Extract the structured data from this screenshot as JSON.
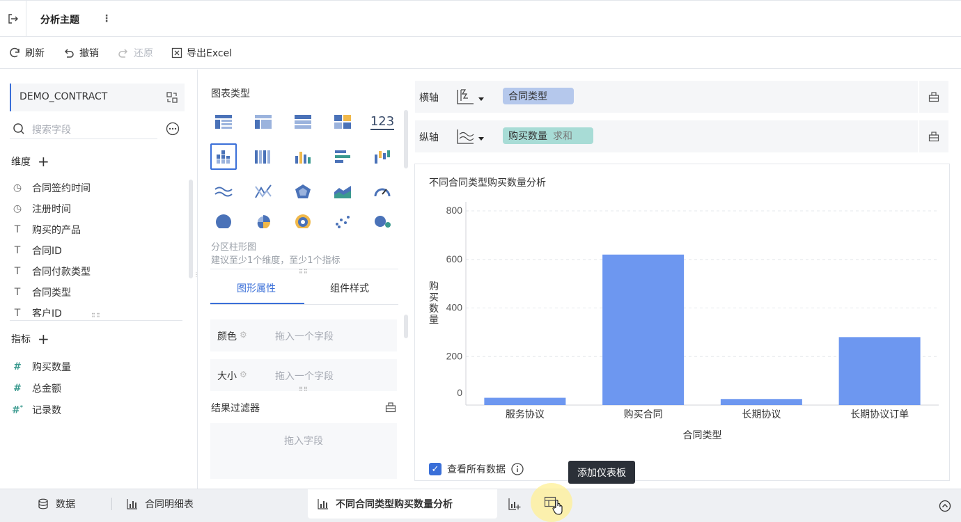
{
  "topbar": {
    "title": "分析主题"
  },
  "toolbar": {
    "refresh": "刷新",
    "undo": "撤销",
    "redo": "还原",
    "export": "导出Excel"
  },
  "left": {
    "table_name": "DEMO_CONTRACT",
    "search_placeholder": "搜索字段",
    "dimensions_title": "维度",
    "dimensions": [
      {
        "label": "合同签约时间",
        "icon": "clock-icon"
      },
      {
        "label": "注册时间",
        "icon": "clock-icon"
      },
      {
        "label": "购买的产品",
        "icon": "text-icon"
      },
      {
        "label": "合同ID",
        "icon": "text-icon"
      },
      {
        "label": "合同付款类型",
        "icon": "text-icon"
      },
      {
        "label": "合同类型",
        "icon": "text-icon"
      },
      {
        "label": "客户ID",
        "icon": "text-icon"
      }
    ],
    "measures_title": "指标",
    "measures": [
      {
        "label": "购买数量",
        "icon": "hash-icon"
      },
      {
        "label": "总金额",
        "icon": "hash-icon"
      },
      {
        "label": "记录数",
        "icon": "hash-star-icon"
      }
    ]
  },
  "middle": {
    "chart_type_title": "图表类型",
    "chart_type_name": "分区柱形图",
    "chart_type_hint": "建议至少1个维度，至少1个指标",
    "tabs": {
      "graph": "图形属性",
      "style": "组件样式"
    },
    "color_label": "颜色",
    "size_label": "大小",
    "drop_placeholder": "拖入一个字段",
    "filter_title": "结果过滤器",
    "filter_placeholder": "拖入字段",
    "number_icon_text": "123"
  },
  "axes": {
    "x_label": "横轴",
    "y_label": "纵轴",
    "x_field": "合同类型",
    "y_field": "购买数量",
    "y_agg": "求和"
  },
  "chart_data": {
    "type": "bar",
    "title": "不同合同类型购买数量分析",
    "categories": [
      "服务协议",
      "购买合同",
      "长期协议",
      "长期协议订单"
    ],
    "values": [
      30,
      620,
      25,
      280
    ],
    "xlabel": "合同类型",
    "ylabel": "购买数量",
    "ylim": [
      0,
      800
    ],
    "yticks": [
      "0",
      "200",
      "400",
      "600",
      "800"
    ],
    "grid": true,
    "color": "#6d97f0"
  },
  "view_all": "查看所有数据",
  "tooltip": "添加仪表板",
  "bottom": {
    "data_tab": "数据",
    "detail_tab": "合同明细表",
    "active_tab": "不同合同类型购买数量分析"
  },
  "colors": {
    "accent": "#3a6fd8",
    "x_pill": "#b5c8ec",
    "y_pill": "#a8dcd6"
  }
}
